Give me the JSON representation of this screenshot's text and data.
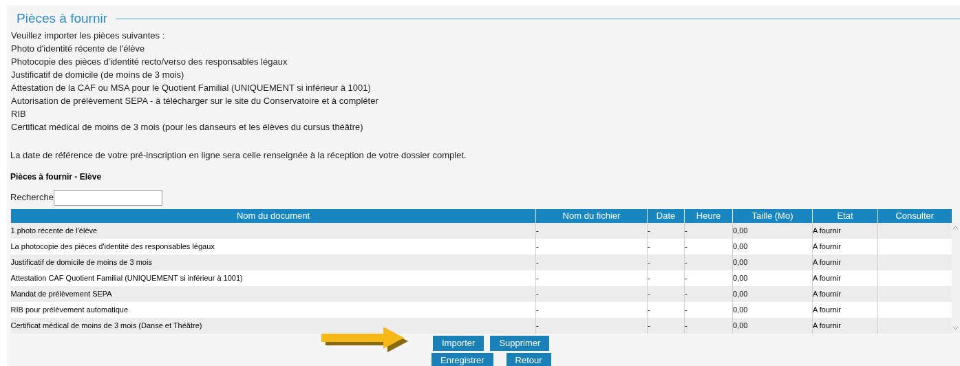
{
  "section_title": "Pièces à fournir",
  "intro_lines": [
    "Veuillez importer les pièces suivantes :",
    "Photo d'identité récente de l'élève",
    "Photocopie des pièces d'identité recto/verso des responsables légaux",
    "Justificatif de domicile (de moins de 3 mois)",
    "Attestation de la CAF ou MSA pour le Quotient Familial (UNIQUEMENT si inférieur à 1001)",
    "Autorisation de prélèvement SEPA - à télécharger sur le site du Conservatoire et à compléter",
    "RIB",
    "Certificat médical de moins de 3 mois (pour les danseurs et les élèves du cursus théâtre)"
  ],
  "note": "La date de référence de votre pré-inscription en ligne sera celle renseignée à la réception de votre dossier complet.",
  "subtitle": "Pièces à fournir - Elève",
  "search": {
    "label": "Recherche"
  },
  "table": {
    "columns": [
      "Nom du document",
      "Nom du fichier",
      "Date",
      "Heure",
      "Taille (Mo)",
      "Etat",
      "Consulter"
    ],
    "rows": [
      [
        "1 photo récente de l'élève",
        "-",
        "-",
        "-",
        "0,00",
        "A fournir"
      ],
      [
        "La photocopie des pièces d'identité des responsables légaux",
        "-",
        "-",
        "-",
        "0,00",
        "A fournir"
      ],
      [
        "Justificatif de domicile de moins de 3 mois",
        "-",
        "-",
        "-",
        "0,00",
        "A fournir"
      ],
      [
        "Attestation CAF Quotient Familial (UNIQUEMENT si inférieur à 1001)",
        "-",
        "-",
        "-",
        "0,00",
        "A fournir"
      ],
      [
        "Mandat de prélèvement SEPA",
        "-",
        "-",
        "-",
        "0,00",
        "A fournir"
      ],
      [
        "RIB pour prélèvement automatique",
        "-",
        "-",
        "-",
        "0,00",
        "A fournir"
      ],
      [
        "Certificat médical de moins de 3 mois (Danse et Théâtre)",
        "-",
        "-",
        "-",
        "0,00",
        "A fournir"
      ]
    ]
  },
  "buttons": [
    [
      "Importer",
      "Supprimer"
    ],
    [
      "Enregistrer",
      "Retour"
    ]
  ]
}
